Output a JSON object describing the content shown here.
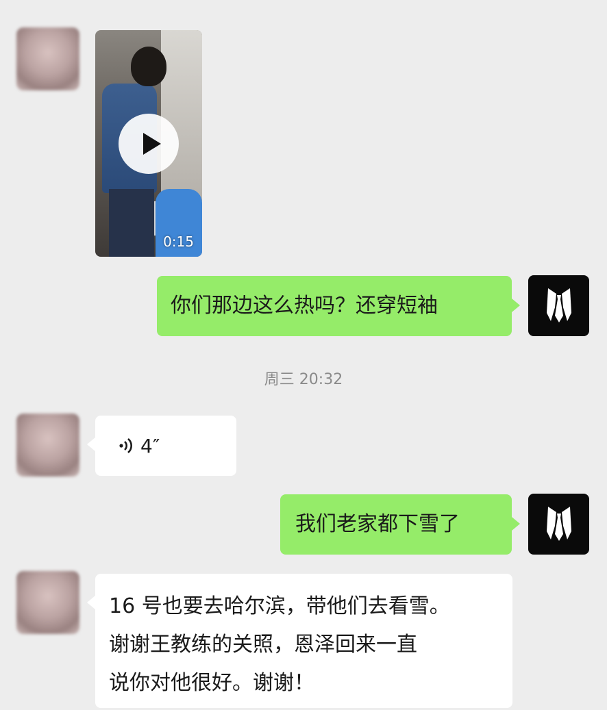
{
  "messages": [
    {
      "side": "left",
      "type": "video",
      "duration": "0:15"
    },
    {
      "side": "right",
      "type": "text",
      "text": "你们那边这么热吗？还穿短袖"
    },
    {
      "type": "timestamp",
      "text": "周三 20:32"
    },
    {
      "side": "left",
      "type": "voice",
      "voice_icon": "voice-wave-icon",
      "length": "4″"
    },
    {
      "side": "right",
      "type": "text",
      "text": "我们老家都下雪了"
    },
    {
      "side": "left",
      "type": "text",
      "lines": [
        "16 号也要去哈尔滨，带他们去看雪。",
        "谢谢王教练的关照，恩泽回来一直",
        "说你对他很好。谢谢！"
      ]
    }
  ],
  "colors": {
    "background": "#ededed",
    "outgoing_bubble": "#95ec69",
    "incoming_bubble": "#ffffff",
    "timestamp": "#8a8a8a"
  },
  "icons": {
    "play": "play-icon",
    "self_avatar": "suit-tie-avatar-icon"
  }
}
